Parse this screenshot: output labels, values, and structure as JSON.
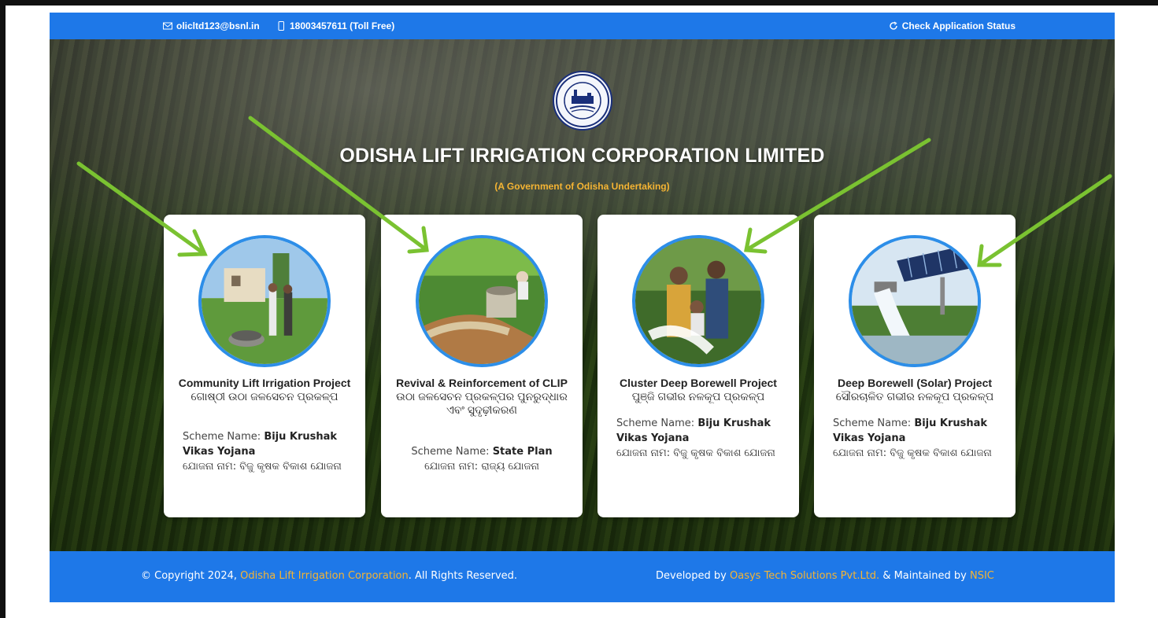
{
  "topbar": {
    "email": "olicltd123@bsnl.in",
    "phone": "18003457611 (Toll Free)",
    "status_link": "Check Application Status",
    "icons": [
      "mail-icon",
      "phone-icon",
      "refresh-icon"
    ]
  },
  "header": {
    "title": "ODISHA LIFT IRRIGATION CORPORATION LIMITED",
    "subtitle": "(A Government of Odisha Undertaking)",
    "logo_name": "olic-seal-logo"
  },
  "cards": [
    {
      "title_en": "Community Lift Irrigation Project",
      "title_or": "ଗୋଷ୍ଠୀ ଉଠା ଜଳସେଚନ ପ୍ରକଳ୍ପ",
      "scheme_label": "Scheme Name:",
      "scheme_value": "Biju Krushak Vikas Yojana",
      "scheme_or": "ଯୋଜନା ନାମ: ବିଜୁ କୃଷକ ବିକାଶ ଯୋଜନା"
    },
    {
      "title_en": "Revival & Reinforcement of CLIP",
      "title_or": "ଉଠା ଜଳସେଚନ ପ୍ରକଳ୍ପର ପୁନରୁଦ୍ଧାର ଏବଂ ସୁଦୃଢ଼ୀକରଣ",
      "scheme_label": "Scheme Name:",
      "scheme_value": "State Plan",
      "scheme_or": "ଯୋଜନା ନାମ: ରାଜ୍ୟ ଯୋଜନା"
    },
    {
      "title_en": "Cluster Deep Borewell Project",
      "title_or": "ପୁଞ୍ଜି ଗଭୀର ନଳକୂପ ପ୍ରକଳ୍ପ",
      "scheme_label": "Scheme Name:",
      "scheme_value": "Biju Krushak Vikas Yojana",
      "scheme_or": "ଯୋଜନା ନାମ: ବିଜୁ କୃଷକ ବିକାଶ ଯୋଜନା"
    },
    {
      "title_en": "Deep Borewell (Solar) Project",
      "title_or": "ସୌରଚାଳିତ ଗଭୀର ନଳକୂପ ପ୍ରକଳ୍ପ",
      "scheme_label": "Scheme Name:",
      "scheme_value": "Biju Krushak Vikas Yojana",
      "scheme_or": "ଯୋଜନା ନାମ: ବିଜୁ କୃଷକ ବିକାଶ ଯୋଜନା"
    }
  ],
  "footer": {
    "copyright_prefix": "© Copyright 2024,",
    "copyright_link": "Odisha Lift Irrigation Corporation",
    "copyright_suffix": ". All Rights Reserved.",
    "dev_prefix": "Developed by",
    "dev_link": "Oasys Tech Solutions Pvt.Ltd.",
    "maint_prefix": "& Maintained by",
    "maint_link": "NSIC"
  },
  "colors": {
    "brand_blue": "#1e78e8",
    "accent_orange": "#f5b433",
    "annotation_green": "#7ac231",
    "card_ring": "#2d8ee8"
  }
}
